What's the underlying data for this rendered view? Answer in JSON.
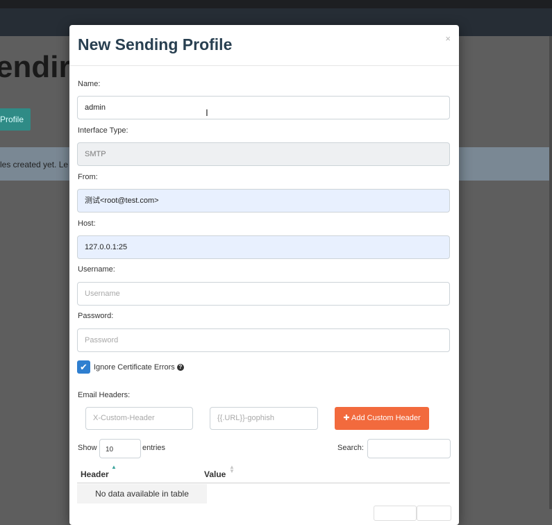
{
  "background": {
    "page_title": "endir",
    "new_profile_button": "Profile",
    "alert_text": "files created yet. Le"
  },
  "modal": {
    "title": "New Sending Profile",
    "close_label": "×",
    "name": {
      "label": "Name:",
      "value": "admin"
    },
    "interface_type": {
      "label": "Interface Type:",
      "value": "SMTP"
    },
    "from": {
      "label": "From:",
      "value": "测试<root@test.com>"
    },
    "host": {
      "label": "Host:",
      "value": "127.0.0.1:25"
    },
    "username": {
      "label": "Username:",
      "placeholder": "Username"
    },
    "password": {
      "label": "Password:",
      "placeholder": "Password"
    },
    "ignore_cert": {
      "label": "Ignore Certificate Errors",
      "checked": true
    },
    "email_headers": {
      "label": "Email Headers:",
      "header_placeholder": "X-Custom-Header",
      "value_placeholder": "{{.URL}}-gophish",
      "add_button": "Add Custom Header"
    },
    "table": {
      "show_label": "Show",
      "entries_value": "10",
      "entries_label": "entries",
      "search_label": "Search:",
      "columns": [
        "Header",
        "Value"
      ],
      "empty_message": "No data available in table"
    }
  },
  "colors": {
    "accent_orange": "#f26a3d",
    "checkbox_blue": "#2f7fd0",
    "title_color": "#283f50",
    "autofill_bg": "#e8f0fe"
  }
}
